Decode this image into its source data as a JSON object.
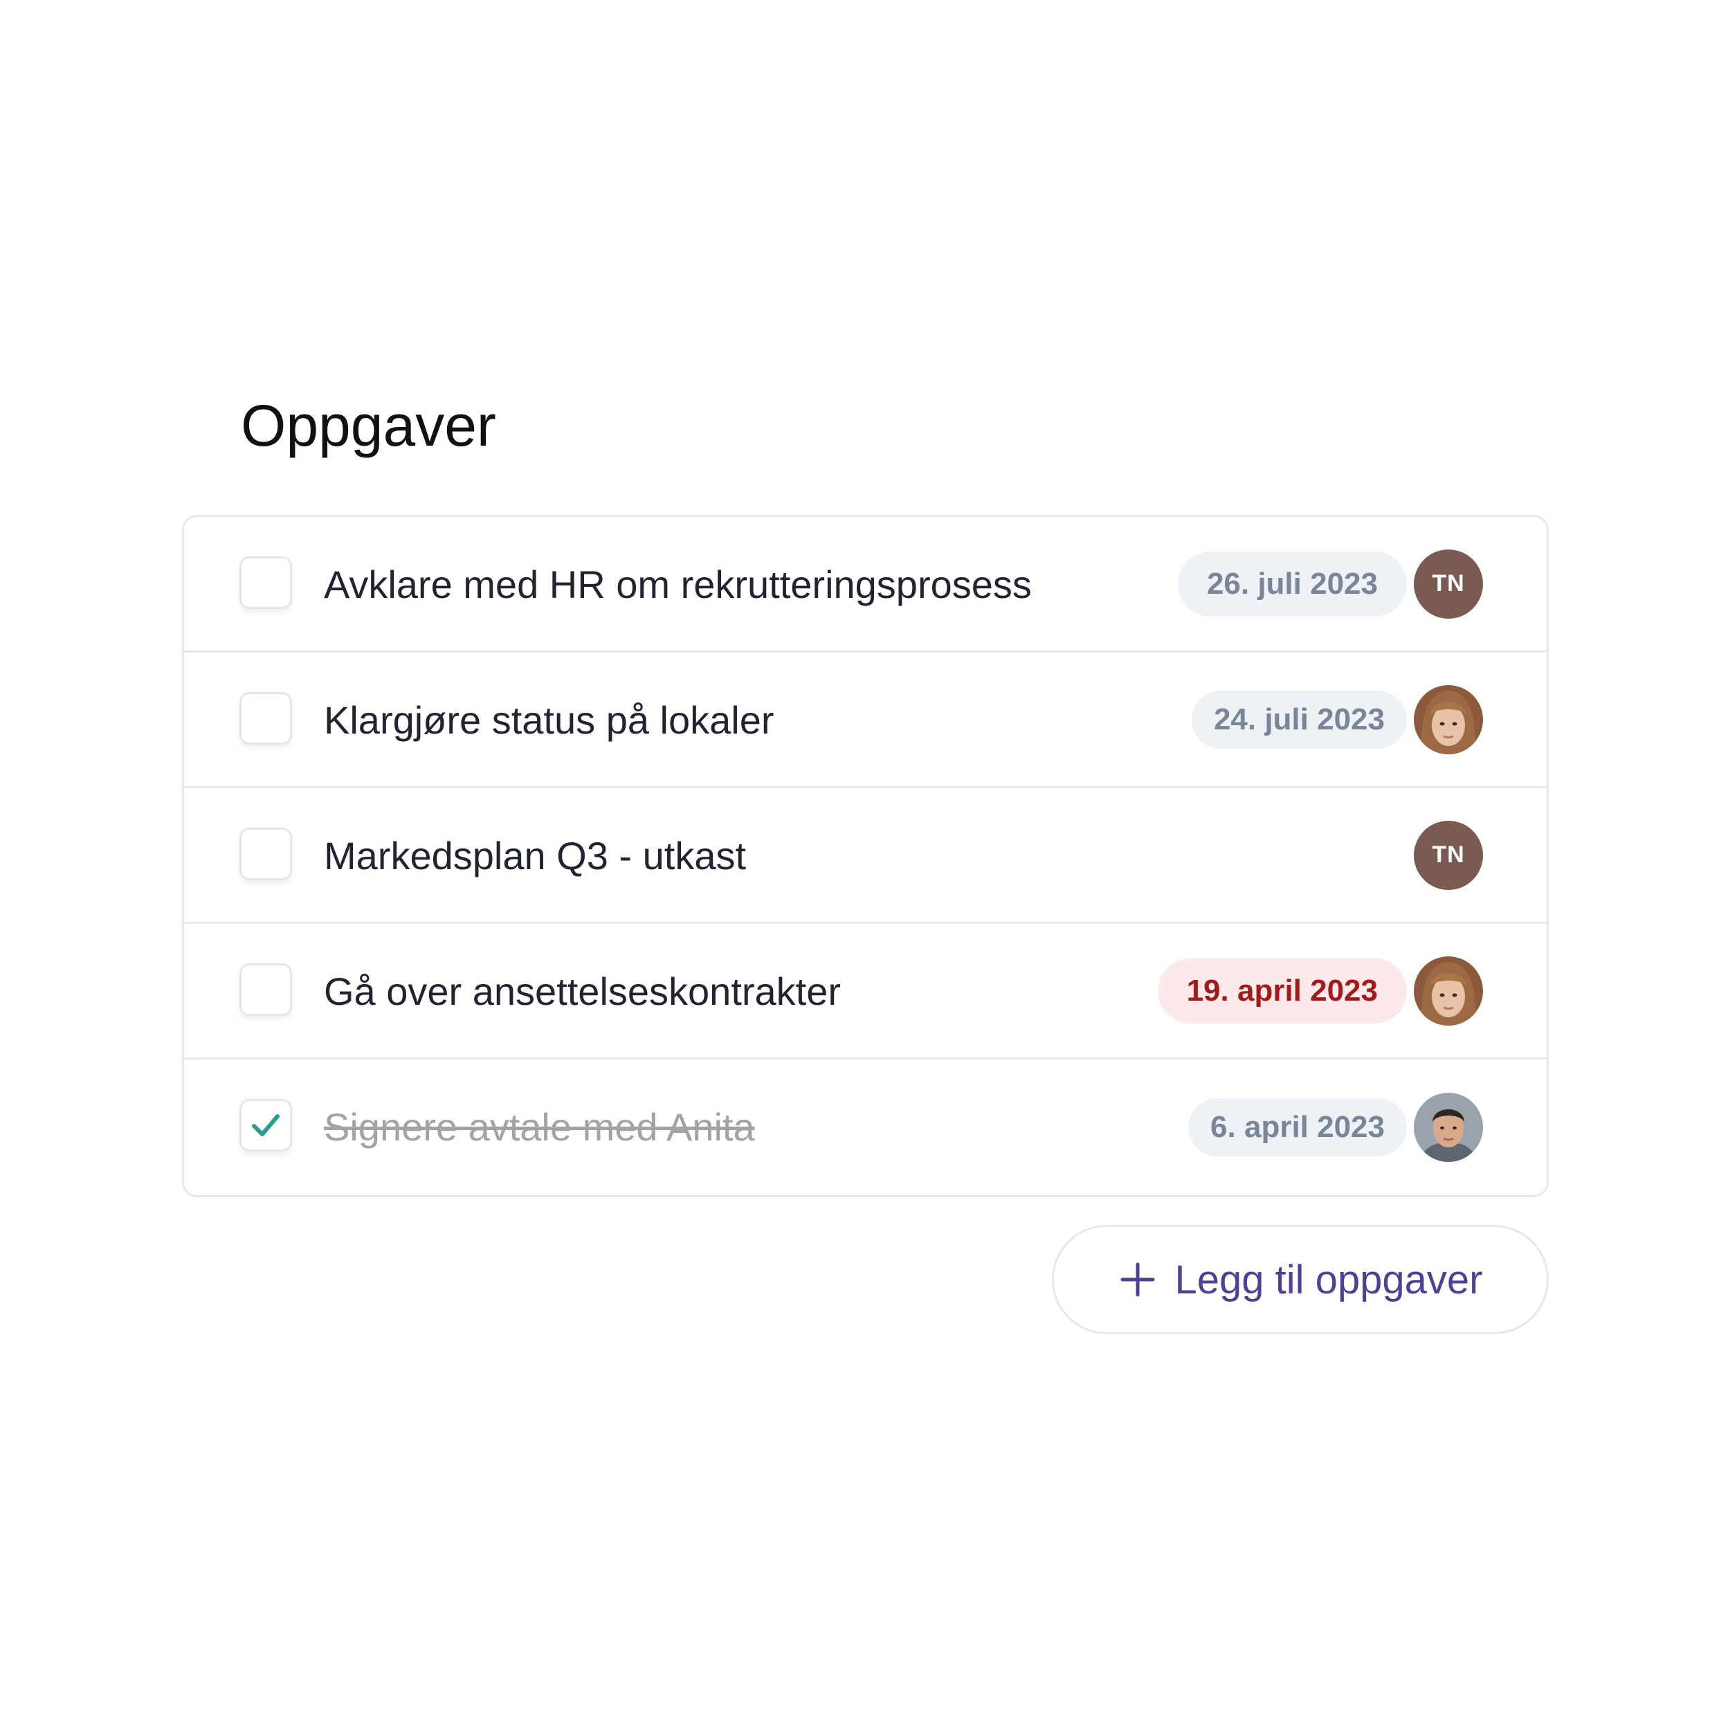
{
  "title": "Oppgaver",
  "tasks": [
    {
      "label": "Avklare med HR om rekrutteringsprosess",
      "due": "26. juli 2023",
      "assignee": "TN",
      "done": false
    },
    {
      "label": "Klargjøre status på lokaler",
      "due": "24. juli 2023",
      "done": false
    },
    {
      "label": "Markedsplan Q3 - utkast",
      "assignee": "TN",
      "done": false
    },
    {
      "label": "Gå over ansettelseskontrakter",
      "due": "19. april 2023",
      "overdue": true,
      "done": false
    },
    {
      "label": "Signere avtale med Anita",
      "due": "6. april 2023",
      "done": true
    }
  ],
  "add_button": {
    "label": "Legg til oppgaver"
  },
  "colors": {
    "accent": "#4f3f96",
    "check": "#2a9d8f",
    "overdue_bg": "#fce9e9",
    "overdue_text": "#a21b1b",
    "pill_bg": "#eef2f7",
    "pill_text": "#7a8597",
    "avatar_initials_bg": "#7b5a52"
  }
}
